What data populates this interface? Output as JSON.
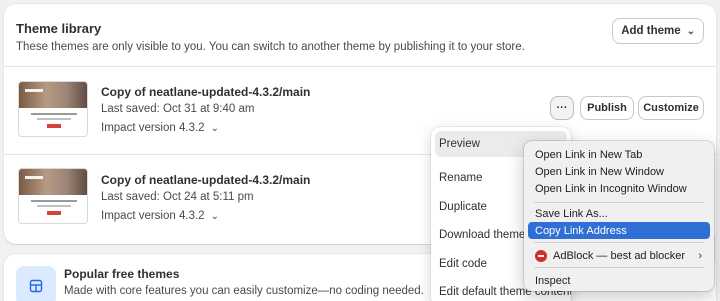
{
  "library": {
    "title": "Theme library",
    "description": "These themes are only visible to you. You can switch to another theme by publishing it to your store.",
    "add_theme_label": "Add theme",
    "themes": [
      {
        "name": "Copy of neatlane-updated-4.3.2/main",
        "saved": "Last saved: Oct 31 at 9:40 am",
        "version": "Impact version 4.3.2",
        "more_label": "···",
        "publish_label": "Publish",
        "customize_label": "Customize"
      },
      {
        "name": "Copy of neatlane-updated-4.3.2/main",
        "saved": "Last saved: Oct 24 at 5:11 pm",
        "version": "Impact version 4.3.2"
      }
    ]
  },
  "popular": {
    "title": "Popular free themes",
    "description": "Made with core features you can easily customize—no coding needed."
  },
  "theme_menu": {
    "items": [
      "Preview",
      "Rename",
      "Duplicate",
      "Download theme f",
      "Edit code",
      "Edit default theme content"
    ]
  },
  "context_menu": {
    "items": [
      "Open Link in New Tab",
      "Open Link in New Window",
      "Open Link in Incognito Window",
      "Save Link As...",
      "Copy Link Address",
      "AdBlock — best ad blocker",
      "Inspect"
    ]
  }
}
